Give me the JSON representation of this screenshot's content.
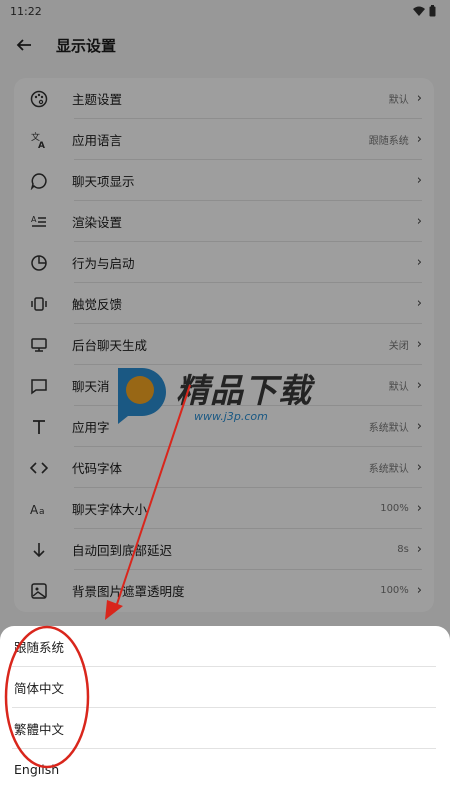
{
  "status_bar": {
    "time": "11:22"
  },
  "header": {
    "title": "显示设置"
  },
  "settings": {
    "items": [
      {
        "label": "主题设置",
        "value": "默认",
        "icon": "palette-icon"
      },
      {
        "label": "应用语言",
        "value": "跟随系统",
        "icon": "translate-icon"
      },
      {
        "label": "聊天项显示",
        "value": "",
        "icon": "chat-bubble-icon"
      },
      {
        "label": "渲染设置",
        "value": "",
        "icon": "text-format-icon"
      },
      {
        "label": "行为与启动",
        "value": "",
        "icon": "pie-chart-icon"
      },
      {
        "label": "触觉反馈",
        "value": "",
        "icon": "vibration-icon"
      },
      {
        "label": "后台聊天生成",
        "value": "关闭",
        "icon": "monitor-icon"
      },
      {
        "label": "聊天消",
        "value": "默认",
        "icon": "message-square-icon"
      },
      {
        "label": "应用字",
        "value": "系统默认",
        "icon": "font-icon"
      },
      {
        "label": "代码字体",
        "value": "系统默认",
        "icon": "code-icon"
      },
      {
        "label": "聊天字体大小",
        "value": "100%",
        "icon": "font-size-icon"
      },
      {
        "label": "自动回到底部延迟",
        "value": "8s",
        "icon": "arrow-down-icon"
      },
      {
        "label": "背景图片遮罩透明度",
        "value": "100%",
        "icon": "image-icon"
      }
    ]
  },
  "language_sheet": {
    "options": [
      "跟随系统",
      "简体中文",
      "繁體中文",
      "English"
    ]
  },
  "watermark": {
    "brand": "精品下载",
    "url": "www.j3p.com"
  },
  "colors": {
    "annotation_red": "#d9261c",
    "watermark_blue": "#2a8fd4",
    "watermark_orange": "#f5a623"
  }
}
